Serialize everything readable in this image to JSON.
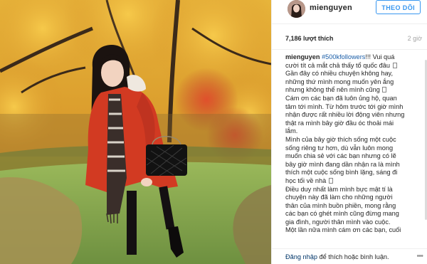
{
  "header": {
    "username": "mienguyen",
    "follow_label": "THEO DÕI"
  },
  "stats": {
    "likes": "7,186 lượt thích",
    "time": "2 giờ"
  },
  "caption": {
    "username": "mienguyen",
    "hashtag": "#500kfollowers",
    "line1_rest": "!!! Vui quá",
    "lines": [
      "cười tít cả mắt chả thấy tổ quốc đâu",
      "Gần đây có nhiều chuyện không hay,",
      "những thứ mình mong muốn yên ắng",
      "nhưng không thể nên mình cũng",
      "Cám ơn các bạn đã luôn ủng hộ, quan",
      "tâm tới mình. Từ hôm trước tới giờ mình",
      "nhận được rất nhiều lời động viên nhưng",
      "thật ra mình bây giờ đầu óc thoải mái",
      "lắm.",
      "Mình của bây giờ thích sống một cuộc",
      "sống riêng tư hơn, dù vẫn luôn mong",
      "muốn chia sẻ với các bạn nhưng có lẽ",
      "bây giờ mình đang dần nhận ra là mình",
      "thích một cuộc sống bình lặng, sáng đi",
      "học tối về nhà",
      "Điều duy nhất làm mình bực mật tí là",
      "chuyện này đã làm cho những người",
      "thân của mình buồn phiền, mong rằng",
      "các bạn có ghét mình cũng đừng mang",
      "gia đình, người thân mình vào cuộc.",
      "Một lần nữa mình cám ơn các bạn, cuối"
    ]
  },
  "footer": {
    "login_link": "Đăng nhập",
    "login_rest": " để thích hoặc bình luận.",
    "more_icon": "more-dots-icon"
  }
}
